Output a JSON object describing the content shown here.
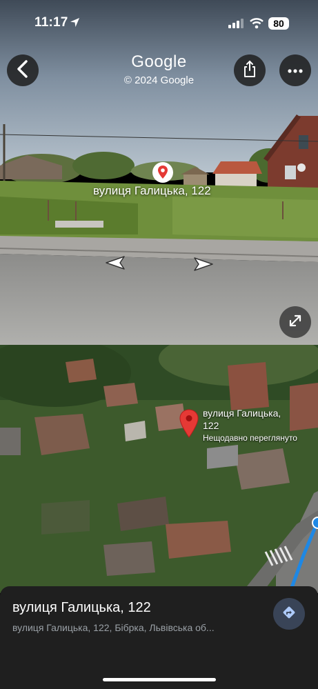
{
  "status_bar": {
    "time": "11:17",
    "battery": "80"
  },
  "header": {
    "title": "Google",
    "copyright": "© 2024 Google"
  },
  "street_view": {
    "place_label": "вулиця Галицька, 122"
  },
  "map": {
    "pin_label_line1": "вулиця Галицька,",
    "pin_label_line2": "122",
    "pin_sublabel": "Нещодавно переглянуто"
  },
  "sheet": {
    "title": "вулиця Галицька, 122",
    "address": "вулиця Галицька, 122, Бібрка, Львівська об..."
  },
  "icons": [
    "back-arrow-icon",
    "share-icon",
    "more-icon",
    "location-pin-icon",
    "nav-left-icon",
    "nav-right-icon",
    "expand-icon",
    "map-pin-icon",
    "directions-icon",
    "location-arrow-icon",
    "signal-icon",
    "wifi-icon"
  ]
}
